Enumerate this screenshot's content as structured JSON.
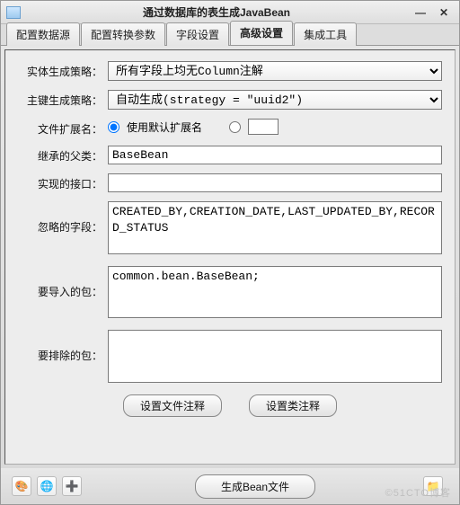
{
  "titlebar": {
    "title": "通过数据库的表生成JavaBean"
  },
  "tabs": {
    "t0": "配置数据源",
    "t1": "配置转换参数",
    "t2": "字段设置",
    "t3": "高级设置",
    "t4": "集成工具"
  },
  "labels": {
    "entityStrategy": "实体生成策略：",
    "pkStrategy": "主键生成策略：",
    "fileExt": "文件扩展名：",
    "parentClass": "继承的父类：",
    "interfaces": "实现的接口：",
    "ignoreFields": "忽略的字段：",
    "imports": "要导入的包：",
    "excludes": "要排除的包："
  },
  "values": {
    "entityStrategy": "所有字段上均无Column注解",
    "pkStrategy": "自动生成(strategy = \"uuid2\")",
    "defaultExt": "使用默认扩展名",
    "parentClass": "BaseBean",
    "interfaces": "",
    "ignoreFields": "CREATED_BY,CREATION_DATE,LAST_UPDATED_BY,RECORD_STATUS",
    "imports": "common.bean.BaseBean;",
    "excludes": ""
  },
  "buttons": {
    "fileComment": "设置文件注释",
    "classComment": "设置类注释",
    "generate": "生成Bean文件"
  },
  "watermark": "©51CTO博客"
}
